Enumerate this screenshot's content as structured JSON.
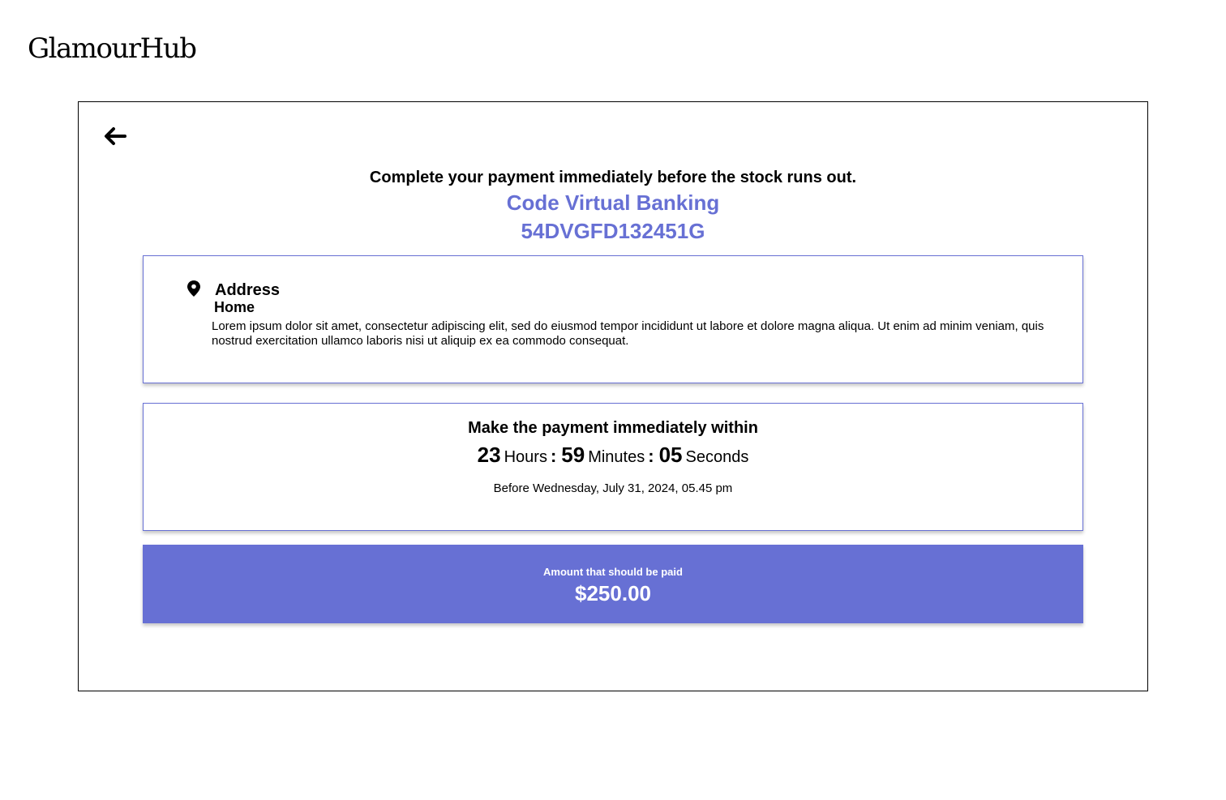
{
  "brand": {
    "logo_text": "GlamourHub"
  },
  "header": {
    "back_icon": "arrow-left-icon",
    "headline": "Complete your payment immediately before the stock runs out.",
    "bank_label": "Code Virtual Banking",
    "bank_code": "54DVGFD132451G"
  },
  "address": {
    "icon": "location-pin-icon",
    "title": "Address",
    "label": "Home",
    "text": "Lorem ipsum dolor sit amet, consectetur adipiscing elit, sed do eiusmod tempor incididunt ut labore et dolore magna aliqua. Ut enim ad minim veniam, quis nostrud exercitation ullamco laboris nisi ut aliquip ex ea commodo consequat."
  },
  "timer": {
    "title": "Make the payment immediately within",
    "hours": "23",
    "hours_label": "Hours",
    "minutes": "59",
    "minutes_label": "Minutes",
    "seconds": "05",
    "seconds_label": "Seconds",
    "separator": ":",
    "deadline": "Before Wednesday, July 31, 2024, 05.45 pm"
  },
  "amount": {
    "label": "Amount that should be paid",
    "value": "$250.00"
  },
  "colors": {
    "accent": "#6770d4",
    "text": "#000000",
    "background": "#ffffff"
  }
}
